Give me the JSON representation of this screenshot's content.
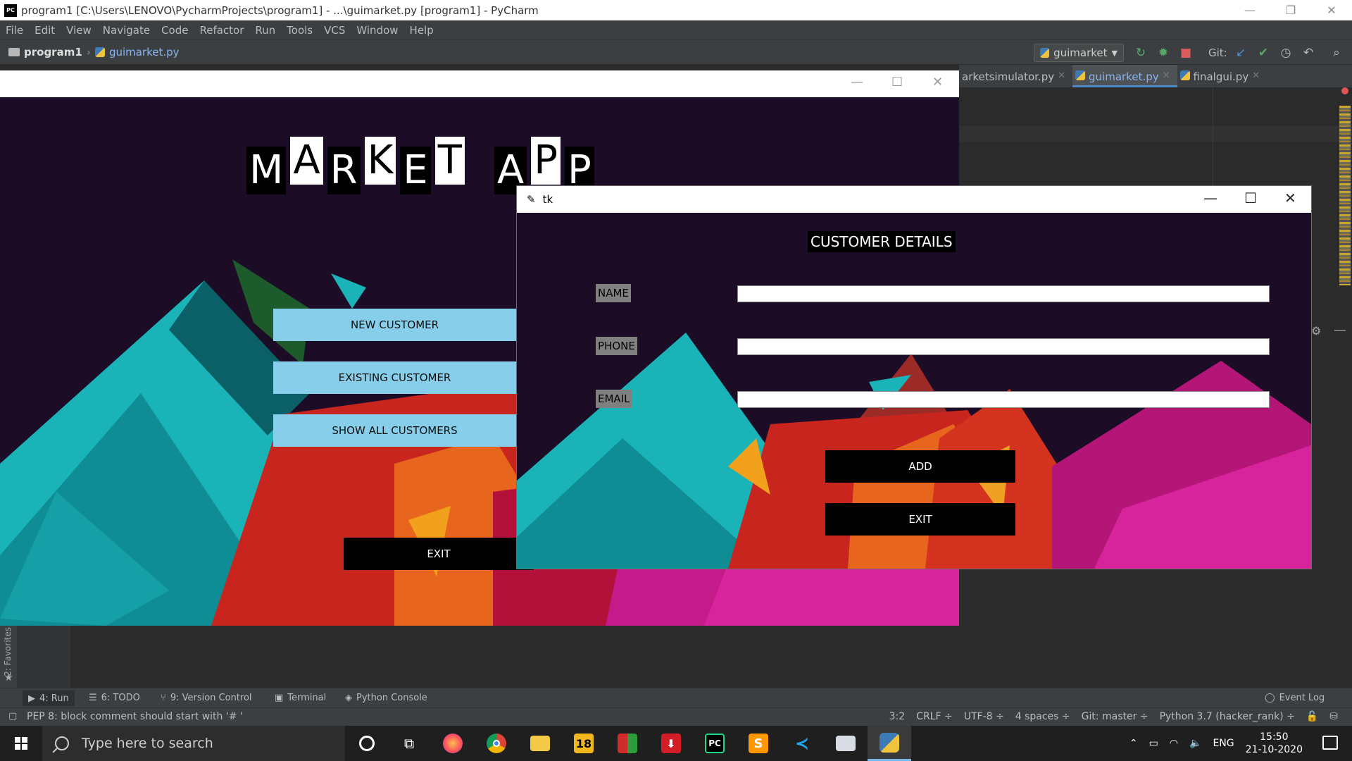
{
  "pycharm": {
    "title": "program1 [C:\\Users\\LENOVO\\PycharmProjects\\program1] - ...\\guimarket.py [program1] - PyCharm",
    "menu": [
      "File",
      "Edit",
      "View",
      "Navigate",
      "Code",
      "Refactor",
      "Run",
      "Tools",
      "VCS",
      "Window",
      "Help"
    ],
    "breadcrumb": {
      "project": "program1",
      "file": "guimarket.py"
    },
    "run_config": "guimarket",
    "git_label": "Git:",
    "tabs": [
      {
        "label": "arketsimulator.py",
        "active": false
      },
      {
        "label": "guimarket.py",
        "active": true
      },
      {
        "label": "finalgui.py",
        "active": false
      }
    ],
    "favorites_label": "2: Favorites",
    "tool_windows": {
      "run": "4: Run",
      "todo": "6: TODO",
      "vcs": "9: Version Control",
      "terminal": "Terminal",
      "python_console": "Python Console",
      "event_log": "Event Log"
    },
    "status": {
      "message": "PEP 8: block comment should start with '# '",
      "position": "3:2",
      "line_sep": "CRLF ÷",
      "encoding": "UTF-8 ÷",
      "indent": "4 spaces ÷",
      "branch": "Git: master ÷",
      "interpreter": "Python 3.7 (hacker_rank) ÷"
    }
  },
  "market_app": {
    "brand_letters": [
      "M",
      "A",
      "R",
      "K",
      "E",
      "T",
      "A",
      "P",
      "P"
    ],
    "buttons": {
      "new_customer": "NEW CUSTOMER",
      "existing_customer": "EXISTING CUSTOMER",
      "show_all": "SHOW ALL CUSTOMERS",
      "exit": "EXIT"
    }
  },
  "customer_window": {
    "title": "tk",
    "heading": "CUSTOMER DETAILS",
    "fields": {
      "name_label": "NAME",
      "phone_label": "PHONE",
      "email_label": "EMAIL",
      "name_value": "",
      "phone_value": "",
      "email_value": ""
    },
    "buttons": {
      "add": "ADD",
      "exit": "EXIT"
    }
  },
  "taskbar": {
    "search_placeholder": "Type here to search",
    "language": "ENG",
    "time": "15:50",
    "date": "21-10-2020",
    "apps": [
      "cortana-icon",
      "task-view-icon",
      "firefox-icon",
      "chrome-icon",
      "file-explorer-icon",
      "app-18-icon",
      "winrar-icon",
      "downloader-icon",
      "pycharm-icon",
      "sublime-icon",
      "vscode-icon",
      "notepad-icon",
      "python-tk-icon"
    ]
  }
}
